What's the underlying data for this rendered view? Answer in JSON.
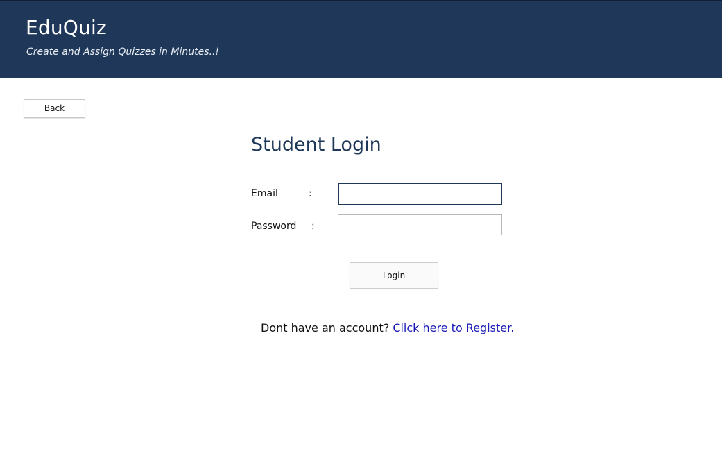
{
  "header": {
    "title": "EduQuiz",
    "tagline": "Create and Assign Quizzes in Minutes..!",
    "background_color": "#1f3759"
  },
  "back_button": {
    "label": "Back"
  },
  "login_form": {
    "title": "Student Login",
    "email": {
      "label": "Email",
      "separator": ":",
      "value": "",
      "placeholder": ""
    },
    "password": {
      "label": "Password",
      "separator": ":",
      "value": "",
      "placeholder": ""
    },
    "submit_label": "Login"
  },
  "register": {
    "prompt": "Dont have an account?",
    "link_text": "Click here to Register.",
    "link_color": "#1a1ab8"
  }
}
